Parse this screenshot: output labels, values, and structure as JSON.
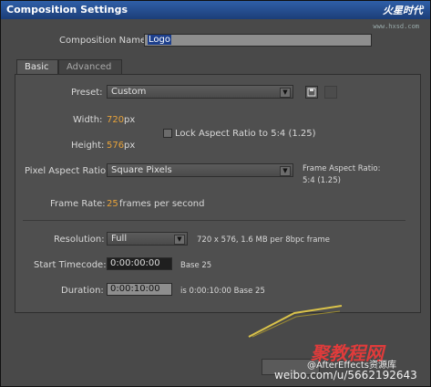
{
  "window": {
    "title": "Composition Settings",
    "brand": "火星时代",
    "brand_url": "www.hxsd.com"
  },
  "composition_name": {
    "label": "Composition Name:",
    "value": "Logo"
  },
  "tabs": [
    {
      "label": "Basic",
      "active": true
    },
    {
      "label": "Advanced",
      "active": false
    }
  ],
  "preset": {
    "label": "Preset:",
    "value": "Custom"
  },
  "width": {
    "label": "Width:",
    "value": "720",
    "unit": "px"
  },
  "height": {
    "label": "Height:",
    "value": "576",
    "unit": "px"
  },
  "lock_aspect": {
    "label": "Lock Aspect Ratio to 5:4 (1.25)",
    "checked": false
  },
  "pixel_aspect": {
    "label": "Pixel Aspect Ratio:",
    "value": "Square Pixels"
  },
  "frame_aspect": {
    "line1": "Frame Aspect Ratio:",
    "line2": "5:4 (1.25)"
  },
  "frame_rate": {
    "label": "Frame Rate:",
    "value": "25",
    "unit": "frames per second"
  },
  "resolution": {
    "label": "Resolution:",
    "value": "Full",
    "info": "720 x 576, 1.6 MB per 8bpc frame"
  },
  "start_timecode": {
    "label": "Start Timecode:",
    "value": "0:00:00:00",
    "base": "Base 25"
  },
  "duration": {
    "label": "Duration:",
    "value": "0:00:10:00",
    "info": "is 0:00:10:00  Base 25"
  },
  "watermark": {
    "line1": "聚教程网",
    "line2": "@AfterEffects资源库",
    "line3": "weibo.com/u/5662192643"
  },
  "colors": {
    "titlebar": "#2f5fa8",
    "accent_value": "#e8a33a",
    "dialog_bg": "#494949"
  }
}
